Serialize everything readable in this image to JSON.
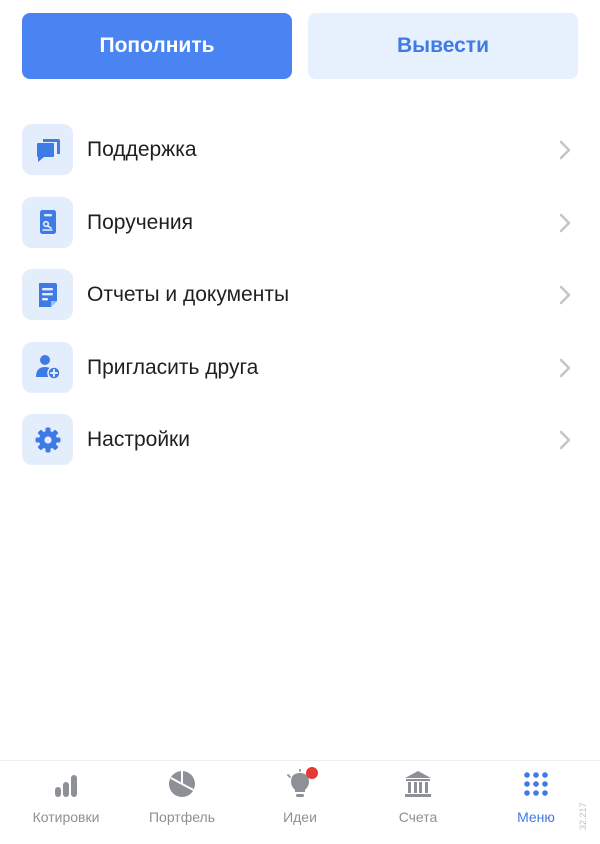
{
  "actions": {
    "deposit_label": "Пополнить",
    "withdraw_label": "Вывести"
  },
  "menu": {
    "items": [
      {
        "label": "Поддержка",
        "icon": "chat-icon"
      },
      {
        "label": "Поручения",
        "icon": "document-icon"
      },
      {
        "label": "Отчеты и документы",
        "icon": "report-icon"
      },
      {
        "label": "Пригласить друга",
        "icon": "add-user-icon"
      },
      {
        "label": "Настройки",
        "icon": "gear-icon"
      }
    ]
  },
  "tabbar": {
    "tabs": [
      {
        "label": "Котировки",
        "icon": "bar-chart-icon"
      },
      {
        "label": "Портфель",
        "icon": "pie-chart-icon"
      },
      {
        "label": "Идеи",
        "icon": "lightbulb-icon",
        "badge": true
      },
      {
        "label": "Счета",
        "icon": "bank-icon"
      },
      {
        "label": "Меню",
        "icon": "grid-icon",
        "active": true
      }
    ]
  },
  "version": "32.217",
  "colors": {
    "accent": "#4a84f2",
    "accent_text": "#3f7be5",
    "icon_bg": "#e4edfc",
    "inactive": "#8d9097",
    "badge": "#e53935"
  }
}
